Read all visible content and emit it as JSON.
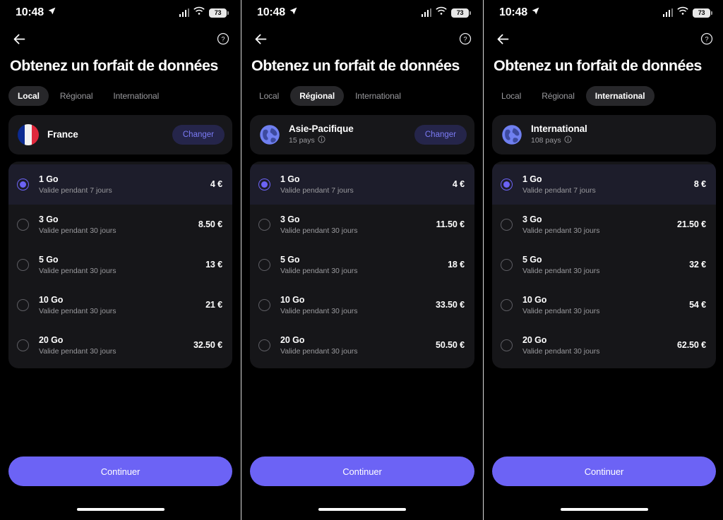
{
  "meta": {
    "accent_color": "#6c63f5",
    "changer_bg": "#25254a",
    "changer_fg": "#7b7bf5",
    "card_bg": "#17171a",
    "selected_row_bg": "#1d1d2b",
    "page_bg": "#000000"
  },
  "status_bar": {
    "time": "10:48",
    "location_icon": "location-arrow-icon",
    "signal_icon": "cellular-signal-icon",
    "wifi_icon": "wifi-icon",
    "battery_icon": "battery-icon",
    "battery_level": "73"
  },
  "nav": {
    "back_icon": "back-arrow-icon",
    "help_icon": "help-circle-icon"
  },
  "page_title": "Obtenez un forfait de données",
  "tabs": [
    {
      "label": "Local"
    },
    {
      "label": "Régional"
    },
    {
      "label": "International"
    }
  ],
  "labels": {
    "changer": "Changer",
    "continuer": "Continuer",
    "info_icon": "info-circle-icon"
  },
  "panels": [
    {
      "id": "local",
      "active_tab": 0,
      "region": {
        "icon": "france-flag-icon",
        "name": "France",
        "subtitle": "",
        "has_info": false,
        "has_changer": true
      },
      "plans": [
        {
          "name": "1 Go",
          "validity": "Valide pendant 7 jours",
          "price": "4 €",
          "selected": true
        },
        {
          "name": "3 Go",
          "validity": "Valide pendant 30 jours",
          "price": "8.50 €",
          "selected": false
        },
        {
          "name": "5 Go",
          "validity": "Valide pendant 30 jours",
          "price": "13 €",
          "selected": false
        },
        {
          "name": "10 Go",
          "validity": "Valide pendant 30 jours",
          "price": "21 €",
          "selected": false
        },
        {
          "name": "20 Go",
          "validity": "Valide pendant 30 jours",
          "price": "32.50 €",
          "selected": false
        }
      ]
    },
    {
      "id": "regional",
      "active_tab": 1,
      "region": {
        "icon": "globe-icon",
        "name": "Asie-Pacifique",
        "subtitle": "15 pays",
        "has_info": true,
        "has_changer": true
      },
      "plans": [
        {
          "name": "1 Go",
          "validity": "Valide pendant 7 jours",
          "price": "4 €",
          "selected": true
        },
        {
          "name": "3 Go",
          "validity": "Valide pendant 30 jours",
          "price": "11.50 €",
          "selected": false
        },
        {
          "name": "5 Go",
          "validity": "Valide pendant 30 jours",
          "price": "18 €",
          "selected": false
        },
        {
          "name": "10 Go",
          "validity": "Valide pendant 30 jours",
          "price": "33.50 €",
          "selected": false
        },
        {
          "name": "20 Go",
          "validity": "Valide pendant 30 jours",
          "price": "50.50 €",
          "selected": false
        }
      ]
    },
    {
      "id": "international",
      "active_tab": 2,
      "region": {
        "icon": "globe-icon",
        "name": "International",
        "subtitle": "108 pays",
        "has_info": true,
        "has_changer": false
      },
      "plans": [
        {
          "name": "1 Go",
          "validity": "Valide pendant 7 jours",
          "price": "8 €",
          "selected": true
        },
        {
          "name": "3 Go",
          "validity": "Valide pendant 30 jours",
          "price": "21.50 €",
          "selected": false
        },
        {
          "name": "5 Go",
          "validity": "Valide pendant 30 jours",
          "price": "32 €",
          "selected": false
        },
        {
          "name": "10 Go",
          "validity": "Valide pendant 30 jours",
          "price": "54 €",
          "selected": false
        },
        {
          "name": "20 Go",
          "validity": "Valide pendant 30 jours",
          "price": "62.50 €",
          "selected": false
        }
      ]
    }
  ]
}
